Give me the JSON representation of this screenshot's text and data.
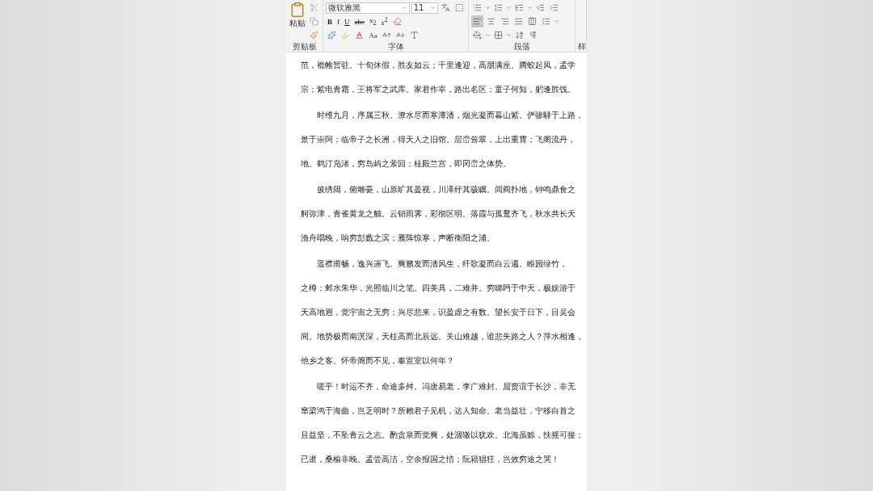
{
  "ribbon": {
    "clipboard": {
      "paste_label": "粘贴",
      "group_label": "剪贴板"
    },
    "font": {
      "font_name": "微软雅黑",
      "font_size": "11",
      "format_buttons": [
        {
          "kind": "bold",
          "label": "B"
        },
        {
          "kind": "italic",
          "label": "I"
        },
        {
          "kind": "underline",
          "label": "U"
        },
        {
          "kind": "strike",
          "label": "abc"
        },
        {
          "kind": "script",
          "label": "x$_{2}$"
        },
        {
          "kind": "script",
          "label": "x$^{2}$"
        }
      ],
      "case_label": "Aa",
      "group_label": "字体"
    },
    "paragraph": {
      "alignment": [
        {
          "selected": true
        },
        {
          "selected": false
        },
        {
          "selected": false
        },
        {
          "selected": false
        },
        {
          "selected": false
        }
      ],
      "group_label": "段落"
    },
    "styles": {
      "group_label": "样"
    }
  },
  "document": {
    "paragraphs": [
      {
        "indented": false,
        "lines": [
          "范，襜帷暂驻。十旬休假，胜友如云；千里逢迎，高朋满座。腾蛟起凤，孟学",
          "宗；紫电青霜，王将军之武库。家君作宰，路出名区；童子何知，躬逢胜饯。"
        ]
      },
      {
        "indented": true,
        "lines": [
          "时维九月，序属三秋。潦水尽而寒潭清，烟光凝而暮山紫。俨骖騑于上路，",
          "景于崇阿；临帝子之长洲，得天人之旧馆。层峦耸翠，上出重霄；飞阁流丹，",
          "地。鹤汀凫渚，穷岛屿之萦回；桂殿兰宫，即冈峦之体势。"
        ]
      },
      {
        "indented": true,
        "lines": [
          "披绣闼，俯雕甍，山原旷其盈视，川泽纡其骇瞩。闾阎扑地，钟鸣鼎食之",
          "舸弥津，青雀黄龙之舳。云销雨霁，彩彻区明。落霞与孤鹜齐飞，秋水共长天",
          "渔舟唱晚，响穷彭蠡之滨；雁阵惊寒，声断衡阳之浦。"
        ]
      },
      {
        "indented": true,
        "lines": [
          "遥襟甫畅，逸兴遄飞。爽籁发而清风生，纤歌凝而白云遏。睢园绿竹，",
          "之樽；邺水朱华，光照临川之笔。四美具，二难并。穷睇眄于中天，极娱游于",
          "天高地迥，觉宇宙之无穷；兴尽悲来，识盈虚之有数。望长安于日下，目吴会",
          "间。地势极而南溟深，天柱高而北辰远。关山难越，谁悲失路之人？萍水相逢，",
          "他乡之客。怀帝阍而不见，奉宣室以何年？"
        ]
      },
      {
        "indented": true,
        "lines": [
          "嗟乎！时运不齐，命途多舛。冯唐易老，李广难封。屈贾谊于长沙，非无",
          "窜梁鸿于海曲，岂乏明时？所赖君子见机，达人知命。老当益壮，宁移白首之",
          "且益坚，不坠青云之志。酌贪泉而觉爽，处涸辙以犹欢。北海虽赊，扶摇可接；",
          "已逝，桑榆非晚。孟尝高洁，空余报国之情；阮籍猖狂，岂效穷途之哭！"
        ]
      }
    ]
  }
}
